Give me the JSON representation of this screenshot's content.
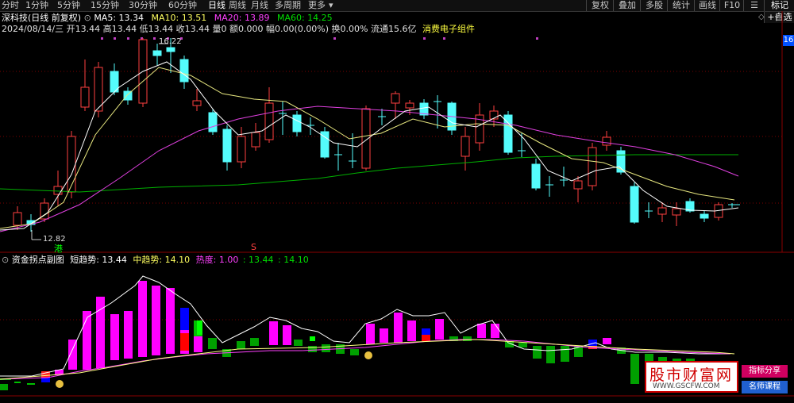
{
  "toolbar": {
    "tabs": [
      "分时",
      "1分钟",
      "5分钟",
      "15分钟",
      "30分钟",
      "60分钟",
      "日线",
      "周线",
      "月线",
      "多周期",
      "更多"
    ],
    "active_tab": "日线",
    "right_buttons": [
      "复权",
      "叠加",
      "多股",
      "统计",
      "画线",
      "F10",
      "☰"
    ],
    "side_buttons": [
      "标记",
      "+自选"
    ]
  },
  "main_chart": {
    "stock_name": "深科技(日线 前复权)",
    "ma5_label": "MA5: 13.34",
    "ma10_label": "MA10: 13.51",
    "ma20_label": "MA20: 13.89",
    "ma60_label": "MA60: 14.25",
    "info_line": "2024/08/14/三 开13.44 高13.44 低13.44 收13.44 量0 额0.000 幅0.00(0.00%) 换0.00% 流通15.6亿",
    "sector": "消费电子组件",
    "high_mark": "16.22",
    "low_mark": "12.82",
    "label_gang": "港",
    "label_s": "S",
    "side_number": "16"
  },
  "sub_chart": {
    "name": "资金拐点副图",
    "short_trend": "短趋势: 13.44",
    "mid_trend": "中趋势: 14.10",
    "heat": "热度: 1.00",
    "v1": ": 13.44",
    "v2": ": 14.10"
  },
  "watermark": {
    "title": "股市财富网",
    "url": "WWW.GSCFW.COM",
    "tag1": "指标分享",
    "tag2": "名师课程"
  },
  "colors": {
    "up": "#ff4040",
    "down": "#54fcfc",
    "ma5": "#ffffff",
    "ma10": "#ffff80",
    "ma20": "#ff40ff",
    "ma60": "#00c000",
    "magenta_bar": "#ff00ff",
    "green_bar": "#00a000"
  }
}
